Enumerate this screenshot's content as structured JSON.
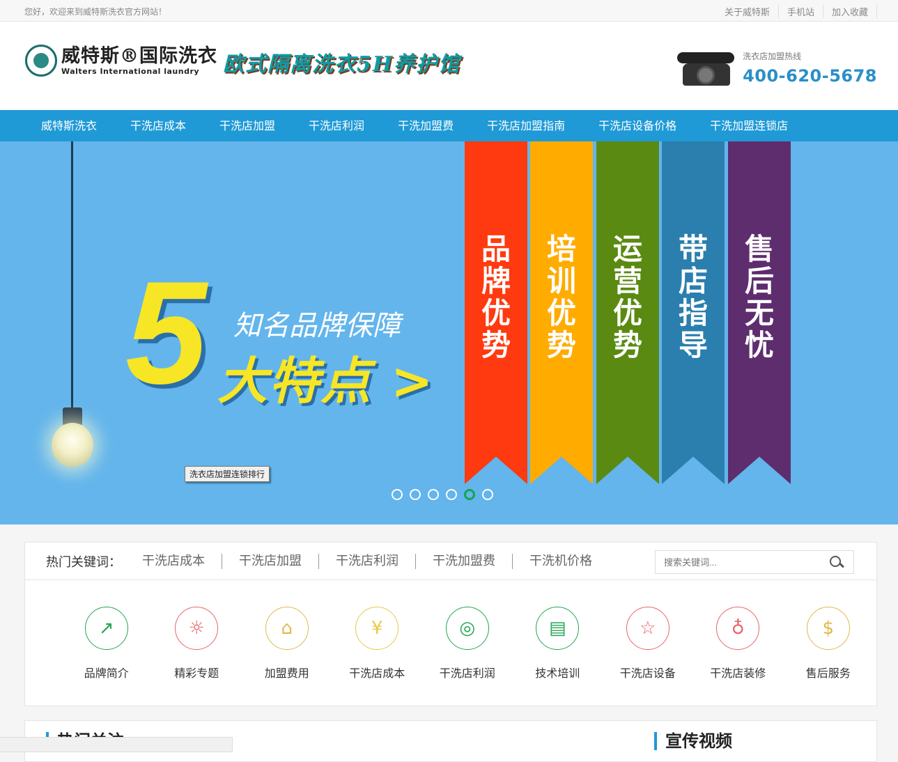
{
  "topbar": {
    "welcome": "您好，欢迎来到威特斯洗衣官方网站！",
    "links": [
      "关于威特斯",
      "手机站",
      "加入收藏"
    ]
  },
  "header": {
    "logo_cn": "威特斯®国际洗衣",
    "logo_en": "Walters International laundry",
    "slogan": "欧式隔离洗衣5H养护馆",
    "hotline_label": "洗衣店加盟热线",
    "hotline_number": "400-620-5678"
  },
  "nav": [
    "威特斯洗衣",
    "干洗店成本",
    "干洗店加盟",
    "干洗店利润",
    "干洗加盟费",
    "干洗店加盟指南",
    "干洗店设备价格",
    "干洗加盟连锁店"
  ],
  "banner": {
    "big_number": "5",
    "subtitle": "知名品牌保障",
    "main": "大特点 >",
    "tooltip": "洗衣店加盟连锁排行",
    "ribbons": [
      {
        "text": "品牌优势",
        "color": "#ff3a10"
      },
      {
        "text": "培训优势",
        "color": "#ffab00"
      },
      {
        "text": "运营优势",
        "color": "#5a8a12"
      },
      {
        "text": "带店指导",
        "color": "#2a7fae"
      },
      {
        "text": "售后无忧",
        "color": "#5e2d6e"
      }
    ],
    "slides_total": 6,
    "active_slide": 5
  },
  "keywords": {
    "label": "热门关键词：",
    "items": [
      "干洗店成本",
      "干洗店加盟",
      "干洗店利润",
      "干洗加盟费",
      "干洗机价格"
    ],
    "search_placeholder": "搜索关键词..."
  },
  "quick_links": [
    {
      "label": "品牌简介",
      "icon": "chart-trend-icon",
      "color": "#23a553",
      "glyph": "↗"
    },
    {
      "label": "精彩专题",
      "icon": "lightbulb-icon",
      "color": "#e8646a",
      "glyph": "☼"
    },
    {
      "label": "加盟费用",
      "icon": "store-icon",
      "color": "#e0b84a",
      "glyph": "⌂"
    },
    {
      "label": "干洗店成本",
      "icon": "yen-icon",
      "color": "#e8c94a",
      "glyph": "¥"
    },
    {
      "label": "干洗店利润",
      "icon": "coins-icon",
      "color": "#23a553",
      "glyph": "◎"
    },
    {
      "label": "技术培训",
      "icon": "book-icon",
      "color": "#23a553",
      "glyph": "▤"
    },
    {
      "label": "干洗店设备",
      "icon": "star-icon",
      "color": "#e8646a",
      "glyph": "☆"
    },
    {
      "label": "干洗店装修",
      "icon": "shirt-icon",
      "color": "#e8646a",
      "glyph": "♁"
    },
    {
      "label": "售后服务",
      "icon": "dollar-head-icon",
      "color": "#e0b84a",
      "glyph": "$"
    }
  ],
  "sections": {
    "left_title": "热门关注",
    "right_title": "宣传视频"
  }
}
